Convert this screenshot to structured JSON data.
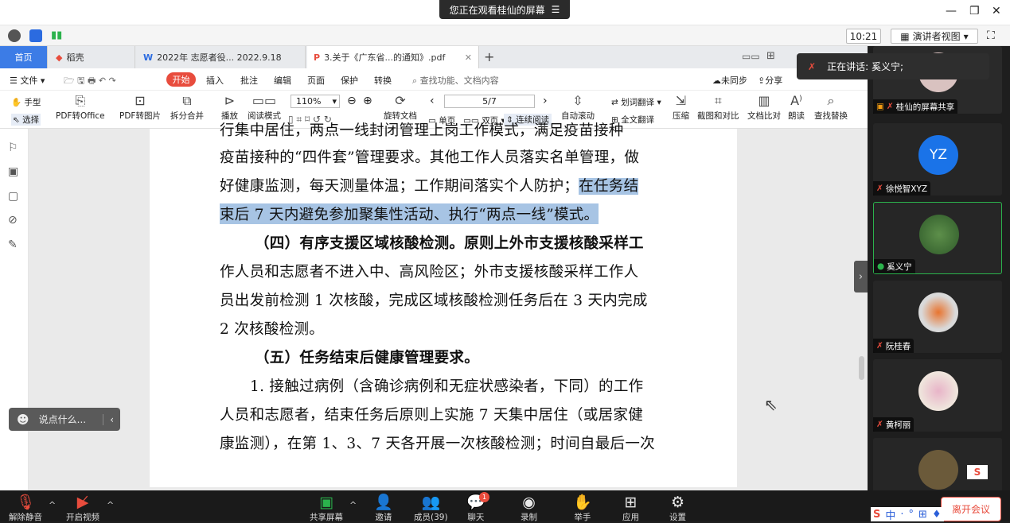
{
  "meeting": {
    "share_notice": "您正在观看桂仙的屏幕",
    "clock": "10:21",
    "view_mode": "演讲者视图",
    "speaking_label": "正在讲话:",
    "speaking_name": "奚义宁;"
  },
  "tabs": {
    "home": "首页",
    "daoke": "稻壳",
    "doc": "2022年 志愿者役... 2022.9.18",
    "pdf": "3.关于《广东省...的通知》.pdf"
  },
  "menu": {
    "file": "文件",
    "start": "开始",
    "items": [
      "插入",
      "批注",
      "编辑",
      "页面",
      "保护",
      "转换"
    ],
    "search": "查找功能、文档内容",
    "unsynced": "未同步",
    "share": "分享"
  },
  "toolbar": {
    "hand": "手型",
    "select": "选择",
    "pdf_office": "PDF转Office",
    "pdf_image": "PDF转图片",
    "split_merge": "拆分合并",
    "play": "播放",
    "read_mode": "阅读模式",
    "zoom": "110%",
    "rotate": "旋转文档",
    "page": "5/7",
    "single": "单页",
    "double": "双页",
    "continuous": "连续阅读",
    "auto_scroll": "自动滚动",
    "word_translate": "划词翻译",
    "full_translate": "全文翻译",
    "compress": "压缩",
    "screenshot": "截图和对比",
    "compare": "文档比对",
    "read_aloud": "朗读",
    "find_replace": "查找替换"
  },
  "document": {
    "lines": [
      "行集中居住，两点一线封闭管理上岗工作模式，满足疫苗接种",
      "疫苗接种的“四件套”管理要求。其他工作人员落实名单管理，做",
      "好健康监测，每天测量体温；工作期间落实个人防护；",
      "在任务结",
      "束后 7 天内避免参加聚集性活动、执行“两点一线”模式。",
      "（四）有序支援区域核酸检测。原则上外市支援核酸采样工",
      "作人员和志愿者不进入中、高风险区；外市支援核酸采样工作人",
      "员出发前检测 1 次核酸，完成区域核酸检测任务后在 3 天内完成",
      "2 次核酸检测。",
      "（五）任务结束后健康管理要求。",
      "1. 接触过病例（含确诊病例和无症状感染者，下同）的工作",
      "人员和志愿者，结束任务后原则上实施 7 天集中居住（或居家健",
      "康监测），在第 1、3、7 天各开展一次核酸检测；时间自最后一次"
    ]
  },
  "comment": {
    "placeholder": "说点什么..."
  },
  "participants": [
    {
      "name": "桂仙的屏幕共享",
      "initials": ""
    },
    {
      "name": "徐悦智XYZ",
      "initials": "YZ"
    },
    {
      "name": "奚义宁",
      "initials": ""
    },
    {
      "name": "阮桂春",
      "initials": ""
    },
    {
      "name": "黄柯丽",
      "initials": ""
    }
  ],
  "bottom": {
    "unmute": "解除静音",
    "video": "开启视频",
    "share": "共享屏幕",
    "invite": "邀请",
    "members": "成员(39)",
    "chat": "聊天",
    "chat_badge": "1",
    "record": "录制",
    "raise_hand": "举手",
    "apps": "应用",
    "settings": "设置",
    "leave": "离开会议",
    "ime": [
      "中",
      "·",
      "°",
      "⊞",
      "♦"
    ]
  },
  "colors": {
    "highlight": "#a7c4e4",
    "accent": "#3c7ce6",
    "danger": "#e84c3d",
    "yz_avatar": "#1a73e8"
  }
}
